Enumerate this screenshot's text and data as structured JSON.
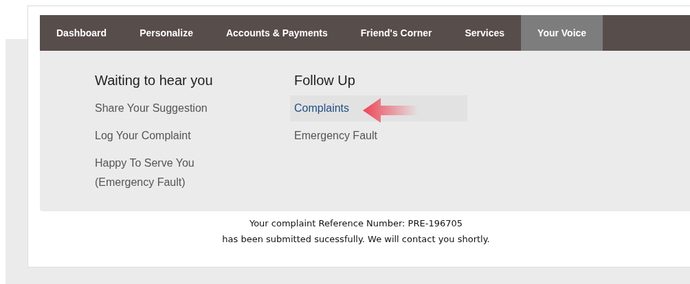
{
  "nav": {
    "tabs": [
      {
        "label": "Dashboard",
        "selected": false
      },
      {
        "label": "Personalize",
        "selected": false
      },
      {
        "label": "Accounts & Payments",
        "selected": false
      },
      {
        "label": "Friend's Corner",
        "selected": false
      },
      {
        "label": "Services",
        "selected": false
      },
      {
        "label": "Your Voice",
        "selected": true
      }
    ]
  },
  "menu": {
    "columns": [
      {
        "heading": "Waiting to hear you",
        "items": [
          {
            "label": "Share Your Suggestion",
            "selected": false
          },
          {
            "label": "Log Your Complaint",
            "selected": false
          },
          {
            "label": "Happy To Serve You (Emergency Fault)",
            "selected": false
          }
        ]
      },
      {
        "heading": "Follow Up",
        "items": [
          {
            "label": "Complaints",
            "selected": true
          },
          {
            "label": "Emergency Fault",
            "selected": false
          }
        ]
      }
    ]
  },
  "message": {
    "lines": [
      "Your complaint Reference Number: PRE-196705",
      "has been submitted sucessfully. We will contact you shortly."
    ]
  }
}
